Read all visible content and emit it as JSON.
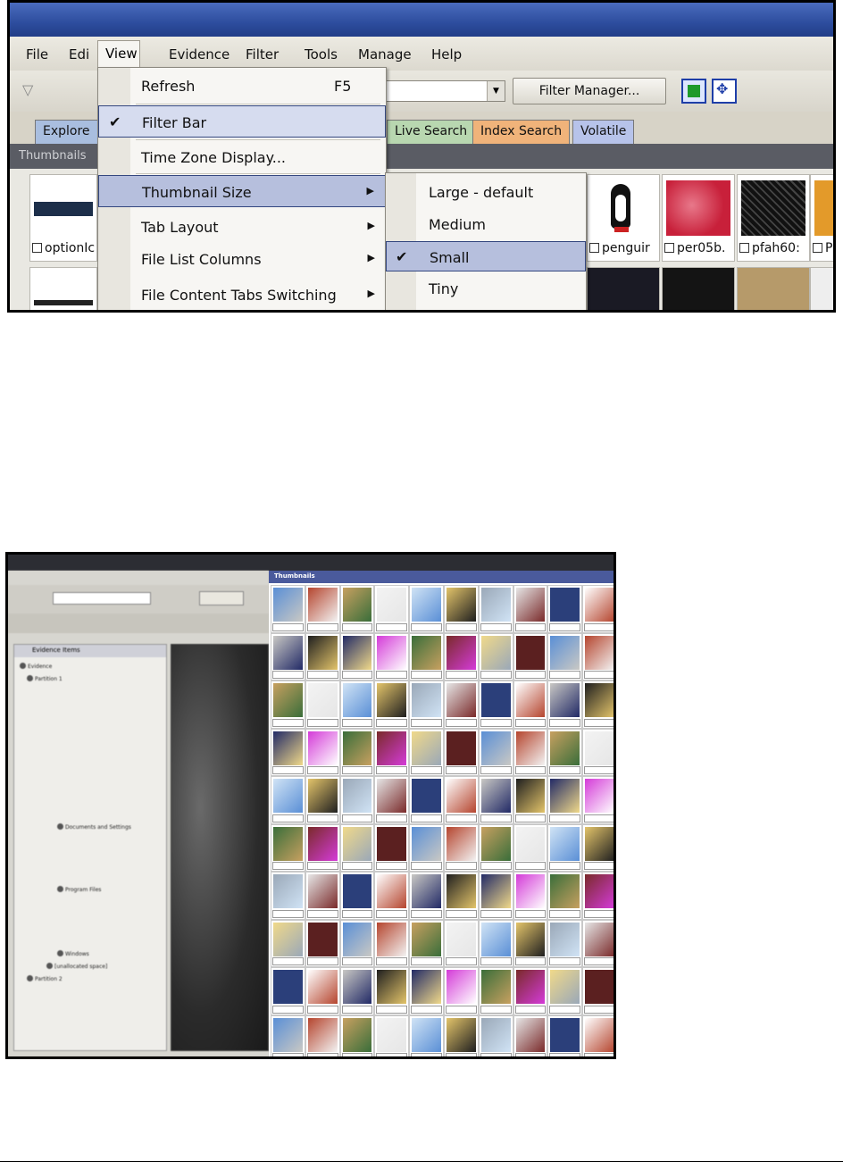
{
  "shot1": {
    "menubar": [
      "File",
      "Edi",
      "View",
      "Evidence",
      "Filter",
      "Tools",
      "Manage",
      "Help"
    ],
    "filter_manager_label": "Filter Manager...",
    "tabs": [
      "Explore",
      "Live Search",
      "Index Search",
      "Volatile"
    ],
    "thumbnails_header": "Thumbnails",
    "thumb_labels": [
      "optionIc",
      "penguir",
      "per05b.",
      "pfah60:",
      "Pi"
    ],
    "view_menu": {
      "items": [
        {
          "label": "Refresh",
          "shortcut": "F5"
        },
        {
          "label": "Filter Bar",
          "checked": true
        },
        {
          "label": "Time Zone Display..."
        },
        {
          "label": "Thumbnail Size",
          "submenu": true,
          "highlighted": true
        },
        {
          "label": "Tab Layout",
          "submenu": true
        },
        {
          "label": "File List Columns",
          "submenu": true
        },
        {
          "label": "File Content Tabs Switching",
          "submenu": true
        }
      ]
    },
    "thumbnail_size_menu": [
      {
        "label": "Large - default"
      },
      {
        "label": "Medium"
      },
      {
        "label": "Small",
        "checked": true,
        "highlighted": true
      },
      {
        "label": "Tiny"
      }
    ],
    "check_glyph": "✔",
    "arrow_glyph": "▶"
  },
  "shot2": {
    "thumbnails_header": "Thumbnails",
    "tree_header": "Evidence Items",
    "tree_rows": [
      "Evidence",
      "Partition 1",
      "Partition 2",
      "[unallocated space]",
      "Documents and Settings",
      "Program Files",
      "Windows"
    ],
    "grid_rows": 10,
    "grid_cols": 10
  }
}
